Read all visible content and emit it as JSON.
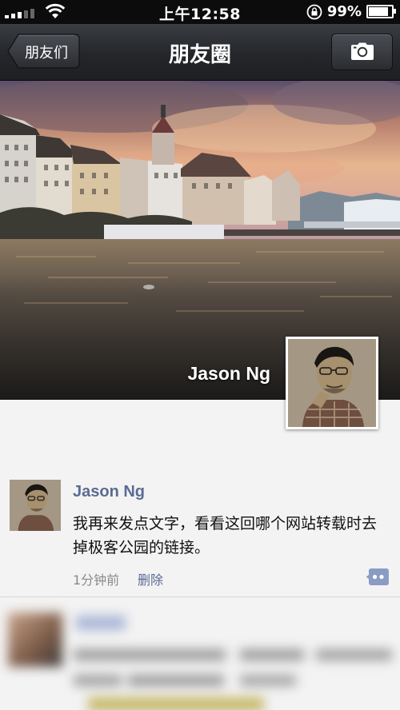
{
  "status_bar": {
    "time": "上午12:58",
    "battery_percent": "99%",
    "battery_level": 0.99,
    "signal_bars": 3,
    "icons": [
      "signal-icon",
      "wifi-icon",
      "rotation-lock-icon",
      "battery-icon"
    ]
  },
  "nav": {
    "back_label": "朋友们",
    "title": "朋友圈",
    "camera_icon": "camera-icon"
  },
  "cover": {
    "name": "Jason Ng"
  },
  "post": {
    "author": "Jason Ng",
    "text": "我再来发点文字，看看这回哪个网站转载时去掉极客公园的链接。",
    "time": "1分钟前",
    "delete_label": "删除",
    "comment_icon": "comment-icon"
  },
  "colors": {
    "link_blue": "#5b6b93",
    "navbar_dark": "#24262a",
    "background": "#f3f3f3"
  }
}
